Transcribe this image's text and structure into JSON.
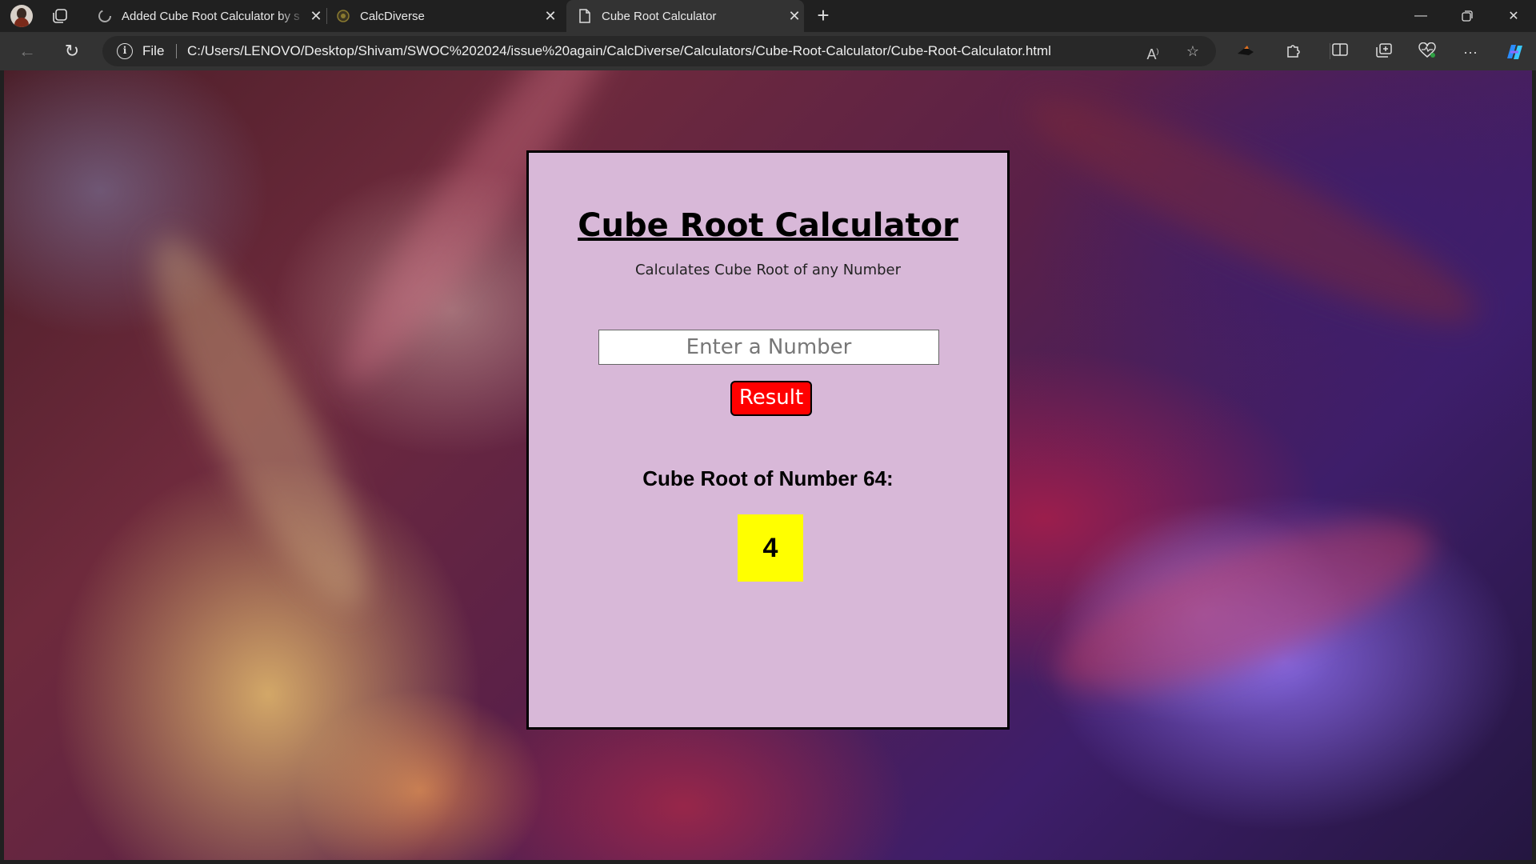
{
  "browser": {
    "tabs": [
      {
        "title": "Added Cube Root Calculator by s",
        "favicon": "github-icon"
      },
      {
        "title": "CalcDiverse",
        "favicon": "calcdiverse-icon"
      },
      {
        "title": "Cube Root Calculator",
        "favicon": "page-icon"
      }
    ],
    "address": {
      "scheme_label": "File",
      "url": "C:/Users/LENOVO/Desktop/Shivam/SWOC%202024/issue%20again/CalcDiverse/Calculators/Cube-Root-Calculator/Cube-Root-Calculator.html"
    }
  },
  "page": {
    "title": "Cube Root Calculator",
    "subtitle": "Calculates Cube Root of any Number",
    "input": {
      "value": "",
      "placeholder": "Enter a Number"
    },
    "button_label": "Result",
    "result_label": "Cube Root of Number 64:",
    "result_value": "4"
  },
  "colors": {
    "card_bg": "#d8b8d8",
    "button_bg": "#ff0000",
    "result_bg": "#ffff00"
  }
}
